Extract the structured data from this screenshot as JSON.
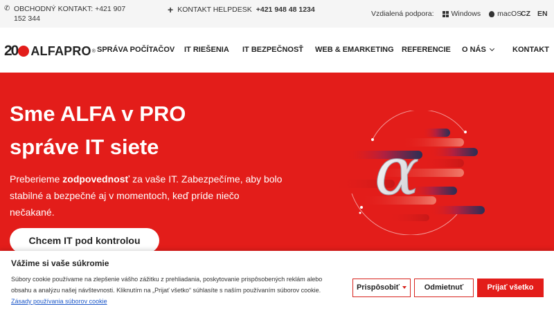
{
  "topbar": {
    "sales_label": "OBCHODNÝ KONTAKT: +421 907 152 344",
    "helpdesk_label": "KONTAKT HELPDESK",
    "helpdesk_number": "+421 948 48 1234",
    "remote_label": "Vzdialená podpora:",
    "windows": "Windows",
    "macos": "macOS",
    "lang_cz": "CZ",
    "lang_en": "EN"
  },
  "logo": {
    "number": "20",
    "text": "ALFAPRO",
    "reg": "®"
  },
  "nav": {
    "items": [
      {
        "label": "SPRÁVA POČÍTAČOV"
      },
      {
        "label": "IT RIEŠENIA"
      },
      {
        "label": "IT BEZPEČNOSŤ"
      },
      {
        "label": "WEB & EMARKETING"
      },
      {
        "label": "REFERENCIE"
      },
      {
        "label": "O NÁS"
      },
      {
        "label": "KONTAKT"
      }
    ]
  },
  "hero": {
    "title_line1": "Sme ALFA v PRO",
    "title_line2": "správe IT siete",
    "text_pre": "Preberieme ",
    "text_bold": "zodpovednosť",
    "text_post": " za vaše IT. Zabezpečíme, aby bolo stabilné a bezpečné aj v momentoch, keď príde niečo nečakané.",
    "cta": "Chcem IT pod kontrolou",
    "glyph": "α"
  },
  "cookie": {
    "title": "Vážime si vaše súkromie",
    "text": "Súbory cookie používame na zlepšenie vášho zážitku z prehliadania, poskytovanie prispôsobených reklám alebo obsahu a analýzu našej návštevnosti. Kliknutím na „Prijať všetko“ súhlasíte s naším používaním súborov cookie. ",
    "link": "Zásady používania súborov cookie",
    "customize": "Prispôsobiť",
    "reject": "Odmietnuť",
    "accept": "Prijať všetko"
  },
  "colors": {
    "brand_red": "#e31d1a",
    "navy": "#2a2f55",
    "white": "#ffffff"
  }
}
